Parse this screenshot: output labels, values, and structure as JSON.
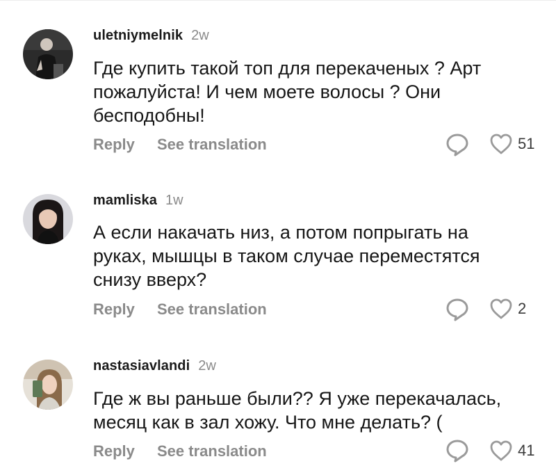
{
  "comments": [
    {
      "username": "uletniymelnik",
      "time": "2w",
      "text": "Где купить такой топ для перекаченых ? Арт\nпожалуйста! И чем моете волосы ? Они\nбесподобны!",
      "reply_label": "Reply",
      "translate_label": "See translation",
      "likes": "51"
    },
    {
      "username": "mamliska",
      "time": "1w",
      "text": "А если накачать низ, а потом попрыгать на\nруках, мышцы в таком случае переместятся\nснизу вверх?",
      "reply_label": "Reply",
      "translate_label": "See translation",
      "likes": "2"
    },
    {
      "username": "nastasiavlandi",
      "time": "2w",
      "text": "Где ж вы раньше были?? Я уже перекачалась,\nмесяц как в зал хожу. Что мне делать? (",
      "reply_label": "Reply",
      "translate_label": "See translation",
      "likes": "41"
    }
  ],
  "icons": {
    "reply": "speech-bubble-icon",
    "like": "heart-outline-icon"
  }
}
